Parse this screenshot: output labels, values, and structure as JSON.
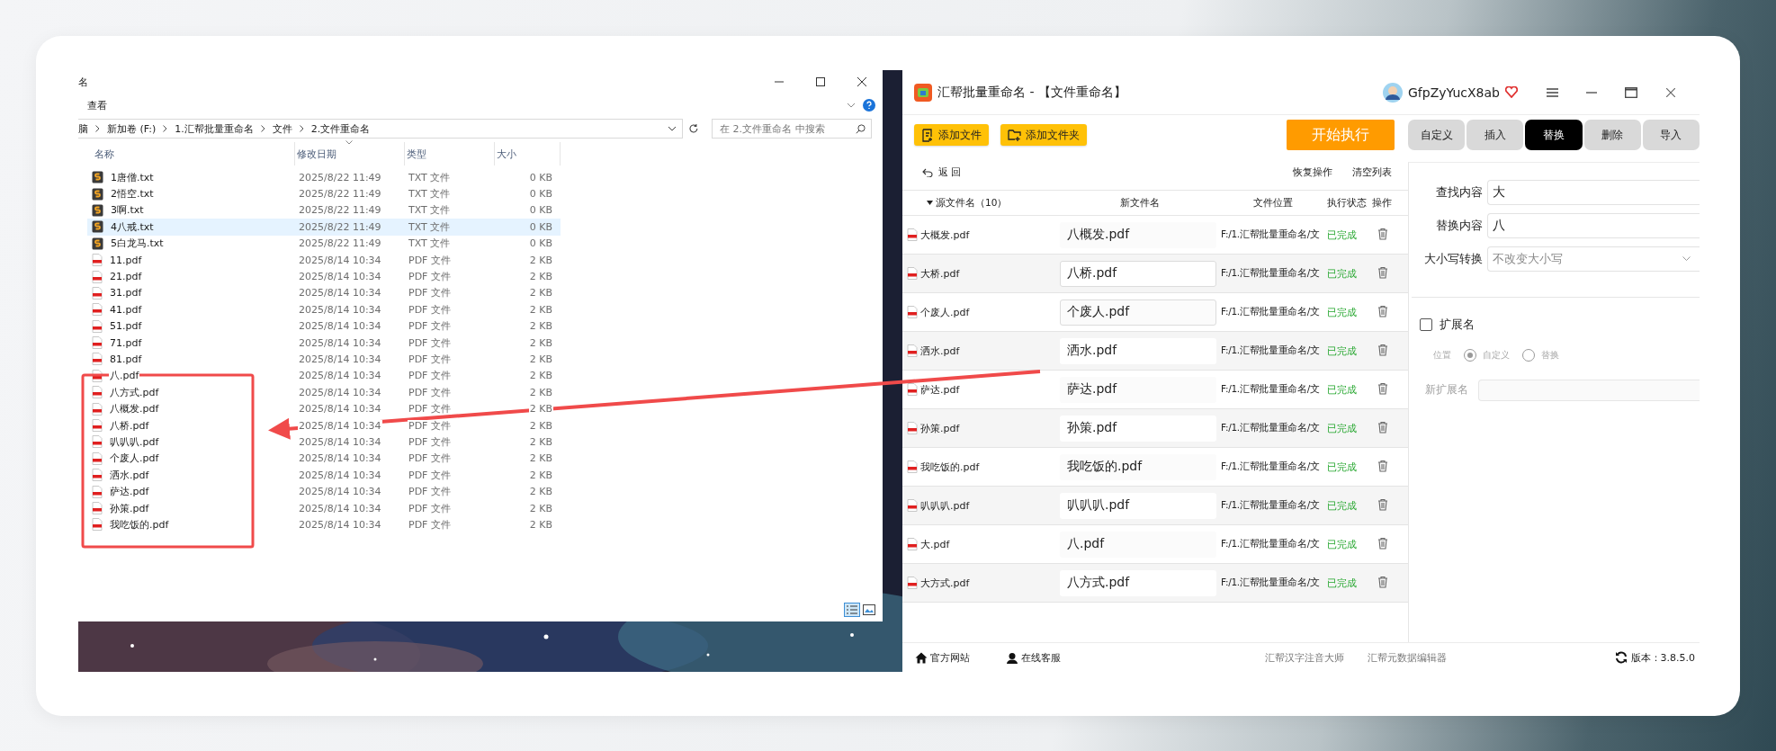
{
  "explorer": {
    "title": "名",
    "ribbon_tab": "查看",
    "breadcrumb": [
      "脑",
      "新加卷 (F:)",
      "1.汇帮批量重命名",
      "文件",
      "2.文件重命名"
    ],
    "search": {
      "placeholder": "在 2.文件重命名 中搜索"
    },
    "columns": [
      "名称",
      "修改日期",
      "类型",
      "大小"
    ],
    "files": [
      {
        "name": "1唐僧.txt",
        "kind": "txt",
        "date": "2025/8/22 11:49",
        "type": "TXT 文件",
        "size": "0 KB",
        "selected": false
      },
      {
        "name": "2悟空.txt",
        "kind": "txt",
        "date": "2025/8/22 11:49",
        "type": "TXT 文件",
        "size": "0 KB",
        "selected": false
      },
      {
        "name": "3啊.txt",
        "kind": "txt",
        "date": "2025/8/22 11:49",
        "type": "TXT 文件",
        "size": "0 KB",
        "selected": false
      },
      {
        "name": "4八戒.txt",
        "kind": "txt",
        "date": "2025/8/22 11:49",
        "type": "TXT 文件",
        "size": "0 KB",
        "selected": true
      },
      {
        "name": "5白龙马.txt",
        "kind": "txt",
        "date": "2025/8/22 11:49",
        "type": "TXT 文件",
        "size": "0 KB",
        "selected": false
      },
      {
        "name": "11.pdf",
        "kind": "pdf",
        "date": "2025/8/14 10:34",
        "type": "PDF 文件",
        "size": "2 KB",
        "selected": false
      },
      {
        "name": "21.pdf",
        "kind": "pdf",
        "date": "2025/8/14 10:34",
        "type": "PDF 文件",
        "size": "2 KB",
        "selected": false
      },
      {
        "name": "31.pdf",
        "kind": "pdf",
        "date": "2025/8/14 10:34",
        "type": "PDF 文件",
        "size": "2 KB",
        "selected": false
      },
      {
        "name": "41.pdf",
        "kind": "pdf",
        "date": "2025/8/14 10:34",
        "type": "PDF 文件",
        "size": "2 KB",
        "selected": false
      },
      {
        "name": "51.pdf",
        "kind": "pdf",
        "date": "2025/8/14 10:34",
        "type": "PDF 文件",
        "size": "2 KB",
        "selected": false
      },
      {
        "name": "71.pdf",
        "kind": "pdf",
        "date": "2025/8/14 10:34",
        "type": "PDF 文件",
        "size": "2 KB",
        "selected": false
      },
      {
        "name": "81.pdf",
        "kind": "pdf",
        "date": "2025/8/14 10:34",
        "type": "PDF 文件",
        "size": "2 KB",
        "selected": false
      },
      {
        "name": "八.pdf",
        "kind": "pdf",
        "date": "2025/8/14 10:34",
        "type": "PDF 文件",
        "size": "2 KB",
        "selected": false
      },
      {
        "name": "八方式.pdf",
        "kind": "pdf",
        "date": "2025/8/14 10:34",
        "type": "PDF 文件",
        "size": "2 KB",
        "selected": false
      },
      {
        "name": "八概发.pdf",
        "kind": "pdf",
        "date": "2025/8/14 10:34",
        "type": "PDF 文件",
        "size": "2 KB",
        "selected": false
      },
      {
        "name": "八桥.pdf",
        "kind": "pdf",
        "date": "2025/8/14 10:34",
        "type": "PDF 文件",
        "size": "2 KB",
        "selected": false
      },
      {
        "name": "叭叭叭.pdf",
        "kind": "pdf",
        "date": "2025/8/14 10:34",
        "type": "PDF 文件",
        "size": "2 KB",
        "selected": false
      },
      {
        "name": "个废人.pdf",
        "kind": "pdf",
        "date": "2025/8/14 10:34",
        "type": "PDF 文件",
        "size": "2 KB",
        "selected": false
      },
      {
        "name": "洒水.pdf",
        "kind": "pdf",
        "date": "2025/8/14 10:34",
        "type": "PDF 文件",
        "size": "2 KB",
        "selected": false
      },
      {
        "name": "萨达.pdf",
        "kind": "pdf",
        "date": "2025/8/14 10:34",
        "type": "PDF 文件",
        "size": "2 KB",
        "selected": false
      },
      {
        "name": "孙策.pdf",
        "kind": "pdf",
        "date": "2025/8/14 10:34",
        "type": "PDF 文件",
        "size": "2 KB",
        "selected": false
      },
      {
        "name": "我吃饭的.pdf",
        "kind": "pdf",
        "date": "2025/8/14 10:34",
        "type": "PDF 文件",
        "size": "2 KB",
        "selected": false
      }
    ]
  },
  "app": {
    "title": "汇帮批量重命名 - 【文件重命名】",
    "user": "GfpZyYucX8ab",
    "add_buttons": [
      {
        "label": "添加文件",
        "kind": "file"
      },
      {
        "label": "添加文件夹",
        "kind": "folder"
      }
    ],
    "start_button": "开始执行",
    "tabs": [
      {
        "label": "自定义",
        "selected": false
      },
      {
        "label": "插入",
        "selected": false
      },
      {
        "label": "替换",
        "selected": true
      },
      {
        "label": "删除",
        "selected": false
      },
      {
        "label": "导入",
        "selected": false
      }
    ],
    "back": "返 回",
    "actions": [
      "恢复操作",
      "清空列表"
    ],
    "columns": [
      "源文件名（10）",
      "新文件名",
      "文件位置",
      "执行状态",
      "操作"
    ],
    "rows": [
      {
        "source": "大概发.pdf",
        "new_name": "八概发.pdf",
        "location": "F:/1.汇帮批量重命名/文",
        "status": "已完成",
        "outlined": false
      },
      {
        "source": "大桥.pdf",
        "new_name": "八桥.pdf",
        "location": "F:/1.汇帮批量重命名/文",
        "status": "已完成",
        "outlined": true
      },
      {
        "source": "个废人.pdf",
        "new_name": "个废人.pdf",
        "location": "F:/1.汇帮批量重命名/文",
        "status": "已完成",
        "outlined": true
      },
      {
        "source": "洒水.pdf",
        "new_name": "洒水.pdf",
        "location": "F:/1.汇帮批量重命名/文",
        "status": "已完成",
        "outlined": false
      },
      {
        "source": "萨达.pdf",
        "new_name": "萨达.pdf",
        "location": "F:/1.汇帮批量重命名/文",
        "status": "已完成",
        "outlined": false
      },
      {
        "source": "孙策.pdf",
        "new_name": "孙策.pdf",
        "location": "F:/1.汇帮批量重命名/文",
        "status": "已完成",
        "outlined": false
      },
      {
        "source": "我吃饭的.pdf",
        "new_name": "我吃饭的.pdf",
        "location": "F:/1.汇帮批量重命名/文",
        "status": "已完成",
        "outlined": false
      },
      {
        "source": "叭叭叭.pdf",
        "new_name": "叭叭叭.pdf",
        "location": "F:/1.汇帮批量重命名/文",
        "status": "已完成",
        "outlined": false
      },
      {
        "source": "大.pdf",
        "new_name": "八.pdf",
        "location": "F:/1.汇帮批量重命名/文",
        "status": "已完成",
        "outlined": false
      },
      {
        "source": "大方式.pdf",
        "new_name": "八方式.pdf",
        "location": "F:/1.汇帮批量重命名/文",
        "status": "已完成",
        "outlined": false
      }
    ],
    "panel": {
      "find": {
        "label": "查找内容",
        "value": "大"
      },
      "replace": {
        "label": "替换内容",
        "value": "八"
      },
      "case": {
        "label": "大小写转换",
        "value": "不改变大小写"
      },
      "extension": {
        "label": "扩展名",
        "checked": false
      },
      "position": {
        "label": "位置",
        "disabled": true,
        "options": [
          {
            "label": "自定义",
            "selected": true
          },
          {
            "label": "替换",
            "selected": false
          }
        ]
      },
      "new_extension": {
        "label": "新扩展名",
        "disabled": true
      }
    },
    "footer": {
      "links": [
        {
          "label": "官方网站",
          "kind": "home"
        },
        {
          "label": "在线客服",
          "kind": "support"
        }
      ],
      "products": [
        "汇帮汉字注音大师",
        "汇帮元数据编辑器"
      ],
      "version": "版本：3.8.5.0"
    }
  }
}
